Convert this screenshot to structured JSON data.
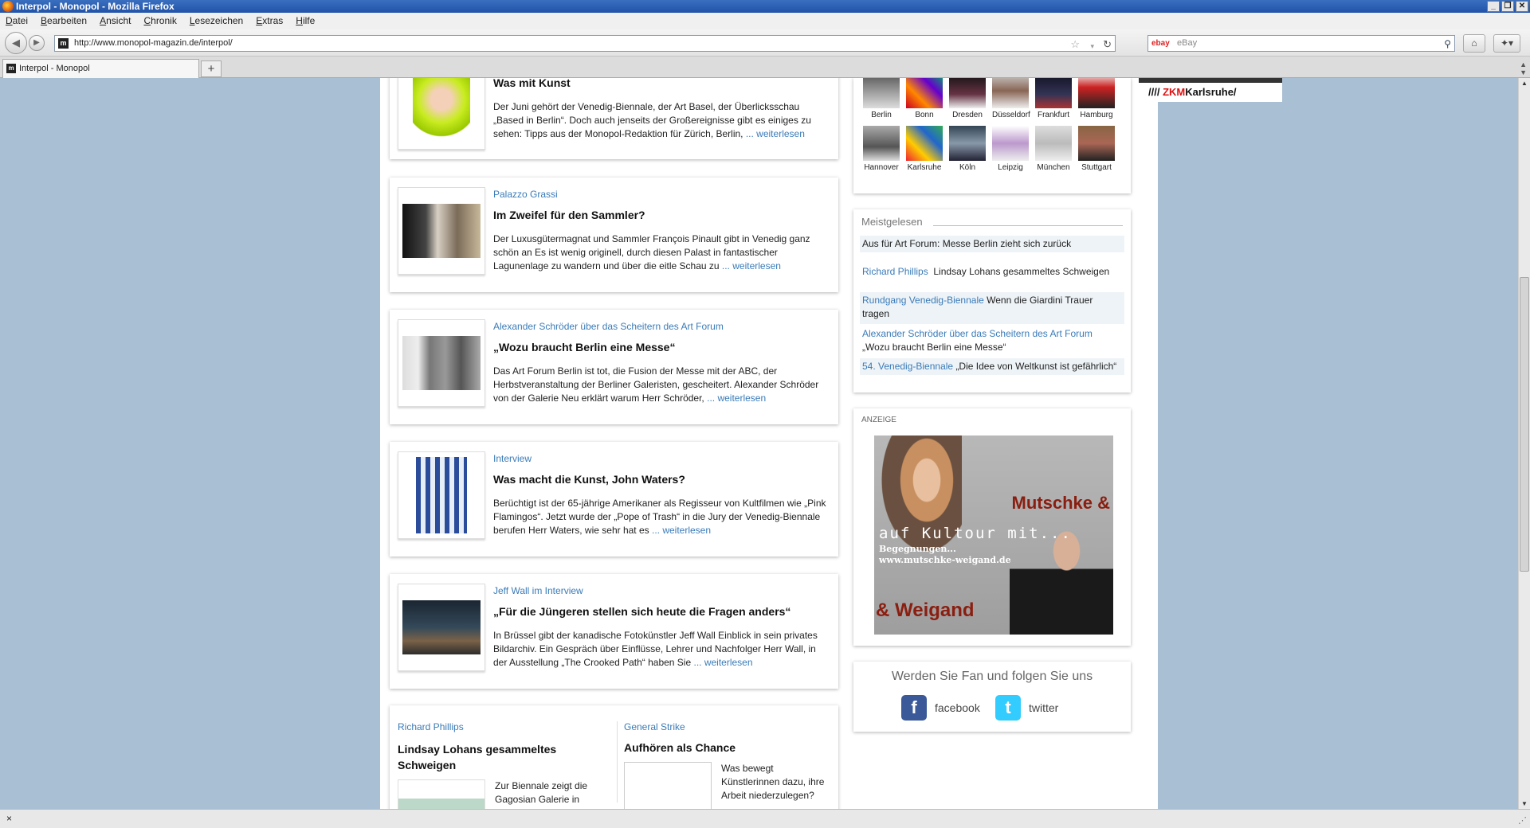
{
  "window": {
    "title": "Interpol - Monopol - Mozilla Firefox"
  },
  "menu": [
    "Datei",
    "Bearbeiten",
    "Ansicht",
    "Chronik",
    "Lesezeichen",
    "Extras",
    "Hilfe"
  ],
  "nav": {
    "url": "http://www.monopol-magazin.de/interpol/",
    "search_placeholder": "eBay",
    "search_engine": "ebay"
  },
  "tabs": [
    {
      "title": "Interpol - Monopol"
    }
  ],
  "articles": [
    {
      "kicker": "",
      "title": "Was mit Kunst",
      "body": "Der Juni gehört der Venedig-Biennale, der Art Basel, der Überlicksschau „Based in Berlin“. Doch auch jenseits der Großereignisse gibt es einiges zu sehen: Tipps aus der Monopol-Redaktion für Zürich, Berlin,",
      "more": "... weiterlesen"
    },
    {
      "kicker": "Palazzo Grassi",
      "title": "Im Zweifel für den Sammler?",
      "body": "Der Luxusgütermagnat und Sammler François Pinault gibt in Venedig ganz schön an Es ist wenig originell, durch diesen Palast in fantastischer Lagunenlage zu wandern und über die eitle Schau zu",
      "more": "... weiterlesen"
    },
    {
      "kicker": "Alexander Schröder über das Scheitern des Art Forum",
      "title": "„Wozu braucht Berlin eine Messe“",
      "body": "Das Art Forum Berlin ist tot, die Fusion der Messe mit der ABC, der Herbstveranstaltung der Berliner Galeristen, gescheitert. Alexander Schröder von der Galerie Neu erklärt warum Herr Schröder,",
      "more": "... weiterlesen"
    },
    {
      "kicker": "Interview",
      "title": "Was macht die Kunst, John Waters?",
      "body": "Berüchtigt ist der 65-jährige Amerikaner als Regisseur von Kultfilmen wie „Pink Flamingos“. Jetzt wurde der „Pope of Trash“ in die Jury der Venedig-Biennale berufen Herr Waters, wie sehr hat es",
      "more": "... weiterlesen"
    },
    {
      "kicker": "Jeff Wall im Interview",
      "title": "„Für die Jüngeren stellen sich heute die Fragen anders“",
      "body": "In Brüssel gibt der kanadische Fotokünstler Jeff Wall Einblick in sein privates Bildarchiv. Ein Gespräch über Einflüsse, Lehrer und Nachfolger Herr Wall, in der Ausstellung „The Crooked Path“ haben Sie",
      "more": "... weiterlesen"
    }
  ],
  "bottom": [
    {
      "kicker": "Richard Phillips",
      "title": "Lindsay Lohans gesammeltes Schweigen",
      "body": "Zur Biennale zeigt die Gagosian Galerie in"
    },
    {
      "kicker": "General Strike",
      "title": "Aufhören als Chance",
      "body": "Was bewegt Künstlerinnen dazu, ihre Arbeit niederzulegen?"
    }
  ],
  "cities": [
    "Berlin",
    "Bonn",
    "Dresden",
    "Düsseldorf",
    "Frankfurt",
    "Hamburg",
    "Hannover",
    "Karlsruhe",
    "Köln",
    "Leipzig",
    "München",
    "Stuttgart"
  ],
  "meistgelesen": {
    "heading": "Meistgelesen",
    "items": [
      {
        "kicker": "",
        "text": "Aus für Art Forum: Messe Berlin zieht sich zurück"
      },
      {
        "kicker": "Richard Phillips",
        "text": "Lindsay Lohans gesammeltes Schweigen"
      },
      {
        "kicker": "Rundgang Venedig-Biennale",
        "text": "Wenn die Giardini Trauer tragen"
      },
      {
        "kicker": "Alexander Schröder über das Scheitern des Art Forum",
        "text": "„Wozu braucht Berlin eine Messe“"
      },
      {
        "kicker": "54. Venedig-Biennale",
        "text": "„Die Idee von Weltkunst ist gefährlich“"
      }
    ]
  },
  "ad": {
    "label": "ANZEIGE",
    "line1": "Mutschke &",
    "line2": "auf Kultour mit...",
    "line3": "Begegnungen...",
    "line4": "www.mutschke-weigand.de",
    "line5": "& Weigand"
  },
  "fan": {
    "heading": "Werden Sie Fan und folgen Sie uns",
    "facebook": "facebook",
    "twitter": "twitter"
  },
  "zkm": {
    "prefix": "//// ",
    "logo": "ZKM",
    "city": "Karlsruhe/"
  },
  "status": {
    "text": "×"
  }
}
